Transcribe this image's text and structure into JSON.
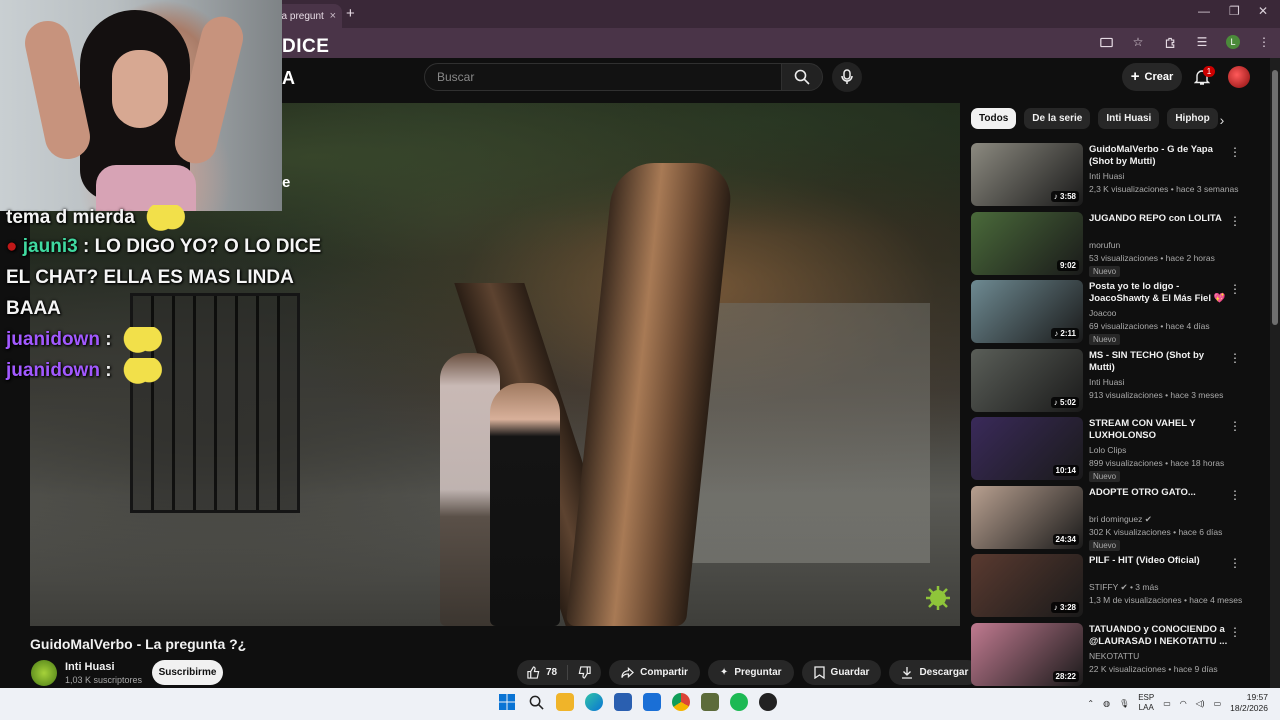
{
  "browser": {
    "tab_title": "La pregunt",
    "tab_close": "×",
    "new_tab": "+",
    "overlay_title_fragment": "DICE",
    "controls": {
      "minimize": "—",
      "maximize": "❐",
      "close": "✕"
    },
    "profile_letter": "L"
  },
  "header": {
    "logo_fragment": "A",
    "search_placeholder": "Buscar",
    "create_label": "Crear",
    "notifications_count": "1"
  },
  "stream_overlay": {
    "partial_text": "e",
    "chat": [
      {
        "user": "",
        "message": "tema d mierda"
      },
      {
        "user": "jauni3",
        "sep": ":",
        "message": "LO DIGO YO? O LO DICE EL CHAT? ELLA ES MAS LINDA BAAA"
      },
      {
        "user": "juanidown",
        "sep": ":"
      },
      {
        "user": "juanidown",
        "sep": ":"
      }
    ]
  },
  "video": {
    "title": "GuidoMalVerbo - La pregunta ?¿",
    "channel": "Inti Huasi",
    "subscribers": "1,03 K suscriptores",
    "subscribe_label": "Suscribirme",
    "likes": "78",
    "share_label": "Compartir",
    "ask_label": "Preguntar",
    "save_label": "Guardar",
    "download_label": "Descargar",
    "more_label": "•••"
  },
  "chips": [
    "Todos",
    "De la serie",
    "Inti Huasi",
    "Hiphop"
  ],
  "recommendations": [
    {
      "title": "GuidoMalVerbo - G de Yapa (Shot by Mutti)",
      "channel": "Inti Huasi",
      "meta": "2,3 K visualizaciones • hace 3 semanas",
      "duration": "♪ 3:58",
      "is_new": false,
      "color": "#8c8a80"
    },
    {
      "title": "JUGANDO REPO con LOLITA",
      "channel": "morufun",
      "meta": "53 visualizaciones • hace 2 horas",
      "duration": "9:02",
      "is_new": true,
      "new_label": "Nuevo",
      "color": "#4a6a3a"
    },
    {
      "title": "Posta yo te lo digo - JoacoShawty & El Más Fiel 💖 ...",
      "channel": "Joacoo",
      "meta": "69 visualizaciones • hace 4 días",
      "duration": "♪ 2:11",
      "is_new": true,
      "new_label": "Nuevo",
      "color": "#6e8a92"
    },
    {
      "title": "MS - SIN TECHO (Shot by Mutti)",
      "channel": "Inti Huasi",
      "meta": "913 visualizaciones • hace 3 meses",
      "duration": "♪ 5:02",
      "is_new": false,
      "color": "#5a5e58"
    },
    {
      "title": "STREAM CON VAHEL Y LUXHOLONSO",
      "channel": "Lolo Clips",
      "meta": "899 visualizaciones • hace 18 horas",
      "duration": "10:14",
      "is_new": true,
      "new_label": "Nuevo",
      "color": "#3a2a5a"
    },
    {
      "title": "ADOPTE OTRO GATO...",
      "channel": "bri dominguez ✔",
      "meta": "302 K visualizaciones • hace 6 días",
      "duration": "24:34",
      "is_new": true,
      "new_label": "Nuevo",
      "color": "#b8a090"
    },
    {
      "title": "PILF - HIT (Video Oficial)",
      "channel": "STIFFY ✔ • 3 más",
      "meta": "1,3 M de visualizaciones • hace 4 meses",
      "duration": "♪ 3:28",
      "is_new": false,
      "color": "#5a3a30"
    },
    {
      "title": "TATUANDO y CONOCIENDO a @LAURASAD l NEKOTATTU ...",
      "channel": "NEKOTATTU",
      "meta": "22 K visualizaciones • hace 9 días",
      "duration": "28:22",
      "is_new": false,
      "color": "#c07a90"
    }
  ],
  "taskbar": {
    "lang_top": "ESP",
    "lang_bottom": "LAA",
    "time": "19:57",
    "date": "18/2/2026"
  }
}
